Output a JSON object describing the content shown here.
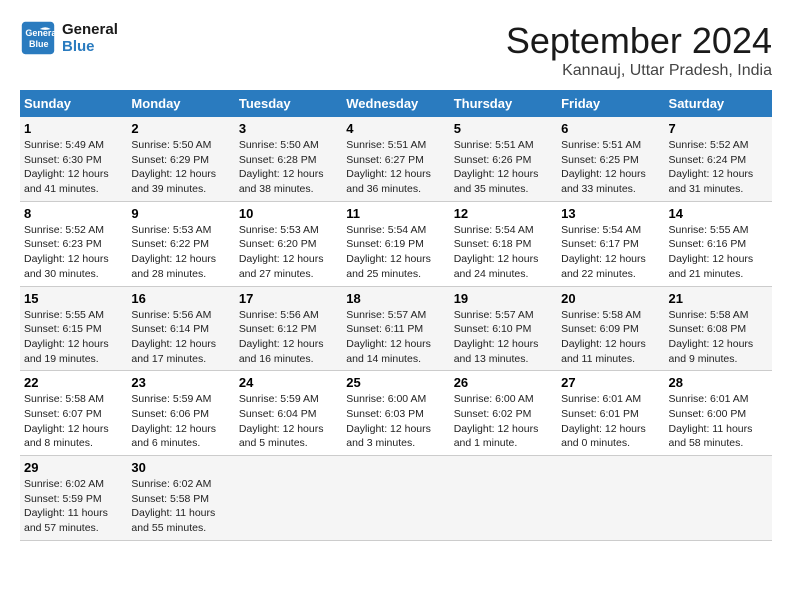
{
  "header": {
    "logo_line1": "General",
    "logo_line2": "Blue",
    "month_year": "September 2024",
    "location": "Kannauj, Uttar Pradesh, India"
  },
  "weekdays": [
    "Sunday",
    "Monday",
    "Tuesday",
    "Wednesday",
    "Thursday",
    "Friday",
    "Saturday"
  ],
  "weeks": [
    [
      {
        "day": "1",
        "info": "Sunrise: 5:49 AM\nSunset: 6:30 PM\nDaylight: 12 hours\nand 41 minutes."
      },
      {
        "day": "2",
        "info": "Sunrise: 5:50 AM\nSunset: 6:29 PM\nDaylight: 12 hours\nand 39 minutes."
      },
      {
        "day": "3",
        "info": "Sunrise: 5:50 AM\nSunset: 6:28 PM\nDaylight: 12 hours\nand 38 minutes."
      },
      {
        "day": "4",
        "info": "Sunrise: 5:51 AM\nSunset: 6:27 PM\nDaylight: 12 hours\nand 36 minutes."
      },
      {
        "day": "5",
        "info": "Sunrise: 5:51 AM\nSunset: 6:26 PM\nDaylight: 12 hours\nand 35 minutes."
      },
      {
        "day": "6",
        "info": "Sunrise: 5:51 AM\nSunset: 6:25 PM\nDaylight: 12 hours\nand 33 minutes."
      },
      {
        "day": "7",
        "info": "Sunrise: 5:52 AM\nSunset: 6:24 PM\nDaylight: 12 hours\nand 31 minutes."
      }
    ],
    [
      {
        "day": "8",
        "info": "Sunrise: 5:52 AM\nSunset: 6:23 PM\nDaylight: 12 hours\nand 30 minutes."
      },
      {
        "day": "9",
        "info": "Sunrise: 5:53 AM\nSunset: 6:22 PM\nDaylight: 12 hours\nand 28 minutes."
      },
      {
        "day": "10",
        "info": "Sunrise: 5:53 AM\nSunset: 6:20 PM\nDaylight: 12 hours\nand 27 minutes."
      },
      {
        "day": "11",
        "info": "Sunrise: 5:54 AM\nSunset: 6:19 PM\nDaylight: 12 hours\nand 25 minutes."
      },
      {
        "day": "12",
        "info": "Sunrise: 5:54 AM\nSunset: 6:18 PM\nDaylight: 12 hours\nand 24 minutes."
      },
      {
        "day": "13",
        "info": "Sunrise: 5:54 AM\nSunset: 6:17 PM\nDaylight: 12 hours\nand 22 minutes."
      },
      {
        "day": "14",
        "info": "Sunrise: 5:55 AM\nSunset: 6:16 PM\nDaylight: 12 hours\nand 21 minutes."
      }
    ],
    [
      {
        "day": "15",
        "info": "Sunrise: 5:55 AM\nSunset: 6:15 PM\nDaylight: 12 hours\nand 19 minutes."
      },
      {
        "day": "16",
        "info": "Sunrise: 5:56 AM\nSunset: 6:14 PM\nDaylight: 12 hours\nand 17 minutes."
      },
      {
        "day": "17",
        "info": "Sunrise: 5:56 AM\nSunset: 6:12 PM\nDaylight: 12 hours\nand 16 minutes."
      },
      {
        "day": "18",
        "info": "Sunrise: 5:57 AM\nSunset: 6:11 PM\nDaylight: 12 hours\nand 14 minutes."
      },
      {
        "day": "19",
        "info": "Sunrise: 5:57 AM\nSunset: 6:10 PM\nDaylight: 12 hours\nand 13 minutes."
      },
      {
        "day": "20",
        "info": "Sunrise: 5:58 AM\nSunset: 6:09 PM\nDaylight: 12 hours\nand 11 minutes."
      },
      {
        "day": "21",
        "info": "Sunrise: 5:58 AM\nSunset: 6:08 PM\nDaylight: 12 hours\nand 9 minutes."
      }
    ],
    [
      {
        "day": "22",
        "info": "Sunrise: 5:58 AM\nSunset: 6:07 PM\nDaylight: 12 hours\nand 8 minutes."
      },
      {
        "day": "23",
        "info": "Sunrise: 5:59 AM\nSunset: 6:06 PM\nDaylight: 12 hours\nand 6 minutes."
      },
      {
        "day": "24",
        "info": "Sunrise: 5:59 AM\nSunset: 6:04 PM\nDaylight: 12 hours\nand 5 minutes."
      },
      {
        "day": "25",
        "info": "Sunrise: 6:00 AM\nSunset: 6:03 PM\nDaylight: 12 hours\nand 3 minutes."
      },
      {
        "day": "26",
        "info": "Sunrise: 6:00 AM\nSunset: 6:02 PM\nDaylight: 12 hours\nand 1 minute."
      },
      {
        "day": "27",
        "info": "Sunrise: 6:01 AM\nSunset: 6:01 PM\nDaylight: 12 hours\nand 0 minutes."
      },
      {
        "day": "28",
        "info": "Sunrise: 6:01 AM\nSunset: 6:00 PM\nDaylight: 11 hours\nand 58 minutes."
      }
    ],
    [
      {
        "day": "29",
        "info": "Sunrise: 6:02 AM\nSunset: 5:59 PM\nDaylight: 11 hours\nand 57 minutes."
      },
      {
        "day": "30",
        "info": "Sunrise: 6:02 AM\nSunset: 5:58 PM\nDaylight: 11 hours\nand 55 minutes."
      },
      {
        "day": "",
        "info": ""
      },
      {
        "day": "",
        "info": ""
      },
      {
        "day": "",
        "info": ""
      },
      {
        "day": "",
        "info": ""
      },
      {
        "day": "",
        "info": ""
      }
    ]
  ]
}
